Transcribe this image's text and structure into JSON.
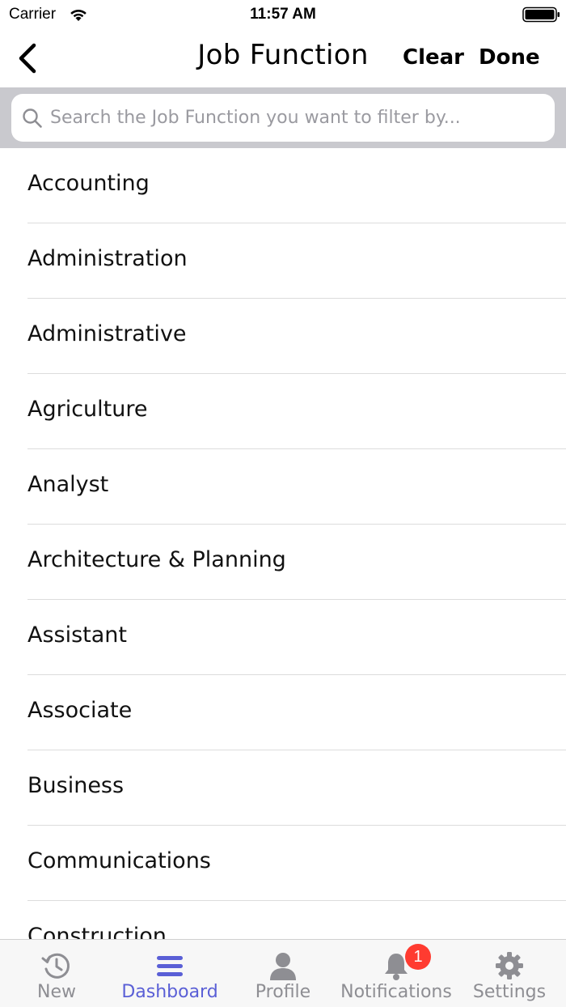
{
  "status_bar": {
    "carrier": "Carrier",
    "time": "11:57 AM"
  },
  "nav": {
    "title": "Job Function",
    "clear_label": "Clear",
    "done_label": "Done"
  },
  "search": {
    "placeholder": "Search the Job Function you want to filter by...",
    "value": ""
  },
  "list": {
    "items": [
      "Accounting",
      "Administration",
      "Administrative",
      "Agriculture",
      "Analyst",
      "Architecture & Planning",
      "Assistant",
      "Associate",
      "Business",
      "Communications",
      "Construction"
    ]
  },
  "tabs": [
    {
      "label": "New",
      "icon": "history-icon"
    },
    {
      "label": "Dashboard",
      "icon": "menu-icon",
      "active": true
    },
    {
      "label": "Profile",
      "icon": "person-icon"
    },
    {
      "label": "Notifications",
      "icon": "bell-icon",
      "badge": "1"
    },
    {
      "label": "Settings",
      "icon": "gear-icon"
    }
  ],
  "colors": {
    "accent": "#5a5fd6",
    "inactive": "#8e8e93",
    "badge": "#ff3b30",
    "search_bg": "#c9c9ce"
  }
}
